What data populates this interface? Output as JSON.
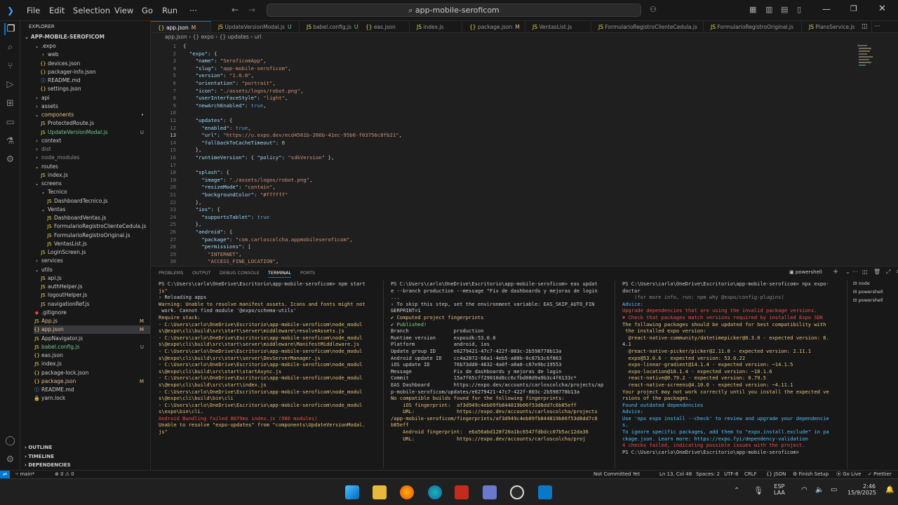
{
  "menu": [
    "File",
    "Edit",
    "Selection",
    "View",
    "Go",
    "Run"
  ],
  "menu_more": "···",
  "search": "app-mobile-seroficom",
  "explorer": {
    "title": "EXPLORER",
    "root": "APP-MOBILE-SEROFICOM",
    "items": [
      {
        "label": ".expo",
        "depth": 1,
        "kind": "folder-open",
        "c": "#ccc"
      },
      {
        "label": "web",
        "depth": 2,
        "kind": "folder",
        "c": "#ccc"
      },
      {
        "label": "devices.json",
        "depth": 2,
        "kind": "json",
        "c": "#ccc"
      },
      {
        "label": "packager-info.json",
        "depth": 2,
        "kind": "json",
        "c": "#ccc"
      },
      {
        "label": "README.md",
        "depth": 2,
        "kind": "md",
        "c": "#ccc"
      },
      {
        "label": "settings.json",
        "depth": 2,
        "kind": "json",
        "c": "#ccc"
      },
      {
        "label": "api",
        "depth": 1,
        "kind": "folder",
        "c": "#ccc"
      },
      {
        "label": "assets",
        "depth": 1,
        "kind": "folder",
        "c": "#ccc"
      },
      {
        "label": "components",
        "depth": 1,
        "kind": "folder-open",
        "c": "#e2c08d",
        "badge": "•"
      },
      {
        "label": "ProtectedRoute.js",
        "depth": 2,
        "kind": "js",
        "c": "#ccc"
      },
      {
        "label": "UpdateVersionModal.js",
        "depth": 2,
        "kind": "js",
        "c": "#73c991",
        "badge": "U"
      },
      {
        "label": "context",
        "depth": 1,
        "kind": "folder",
        "c": "#ccc"
      },
      {
        "label": "dist",
        "depth": 1,
        "kind": "folder",
        "c": "#8c8c8c"
      },
      {
        "label": "node_modules",
        "depth": 1,
        "kind": "folder",
        "c": "#8c8c8c"
      },
      {
        "label": "routes",
        "depth": 1,
        "kind": "folder-open",
        "c": "#ccc"
      },
      {
        "label": "index.js",
        "depth": 2,
        "kind": "js",
        "c": "#ccc"
      },
      {
        "label": "screens",
        "depth": 1,
        "kind": "folder-open",
        "c": "#ccc"
      },
      {
        "label": "Tecnico",
        "depth": 2,
        "kind": "folder-open",
        "c": "#ccc"
      },
      {
        "label": "DashboardTecnico.js",
        "depth": 3,
        "kind": "js",
        "c": "#ccc"
      },
      {
        "label": "Ventas",
        "depth": 2,
        "kind": "folder-open",
        "c": "#ccc"
      },
      {
        "label": "DashboardVentas.js",
        "depth": 3,
        "kind": "js",
        "c": "#ccc"
      },
      {
        "label": "FormularioRegistroClienteCedula.js",
        "depth": 3,
        "kind": "js",
        "c": "#ccc"
      },
      {
        "label": "FormularioRegistroOriginal.js",
        "depth": 3,
        "kind": "js",
        "c": "#ccc"
      },
      {
        "label": "VentasList.js",
        "depth": 3,
        "kind": "js",
        "c": "#ccc"
      },
      {
        "label": "LoginScreen.js",
        "depth": 2,
        "kind": "js",
        "c": "#ccc"
      },
      {
        "label": "services",
        "depth": 1,
        "kind": "folder",
        "c": "#ccc"
      },
      {
        "label": "utils",
        "depth": 1,
        "kind": "folder-open",
        "c": "#ccc"
      },
      {
        "label": "api.js",
        "depth": 2,
        "kind": "js",
        "c": "#ccc"
      },
      {
        "label": "authHelper.js",
        "depth": 2,
        "kind": "js",
        "c": "#ccc"
      },
      {
        "label": "logoutHelper.js",
        "depth": 2,
        "kind": "js",
        "c": "#ccc"
      },
      {
        "label": "navigationRef.js",
        "depth": 2,
        "kind": "js",
        "c": "#ccc"
      },
      {
        "label": ".gitignore",
        "depth": 1,
        "kind": "git",
        "c": "#ccc"
      },
      {
        "label": "App.js",
        "depth": 1,
        "kind": "js",
        "c": "#e2c08d",
        "badge": "M"
      },
      {
        "label": "app.json",
        "depth": 1,
        "kind": "json",
        "c": "#e2c08d",
        "badge": "M",
        "selected": true
      },
      {
        "label": "AppNavigator.js",
        "depth": 1,
        "kind": "js",
        "c": "#ccc"
      },
      {
        "label": "babel.config.js",
        "depth": 1,
        "kind": "js",
        "c": "#73c991",
        "badge": "U"
      },
      {
        "label": "eas.json",
        "depth": 1,
        "kind": "json",
        "c": "#ccc"
      },
      {
        "label": "index.js",
        "depth": 1,
        "kind": "js",
        "c": "#ccc"
      },
      {
        "label": "package-lock.json",
        "depth": 1,
        "kind": "json",
        "c": "#ccc"
      },
      {
        "label": "package.json",
        "depth": 1,
        "kind": "json",
        "c": "#e2c08d",
        "badge": "M"
      },
      {
        "label": "README.md",
        "depth": 1,
        "kind": "md",
        "c": "#ccc"
      },
      {
        "label": "yarn.lock",
        "depth": 1,
        "kind": "lock",
        "c": "#ccc"
      }
    ],
    "sections": [
      "OUTLINE",
      "TIMELINE",
      "DEPENDENCIES"
    ]
  },
  "tabs": [
    {
      "label": "app.json",
      "badge": "M",
      "active": true
    },
    {
      "label": "UpdateVersionModal.js",
      "badge": "U"
    },
    {
      "label": "babel.config.js",
      "badge": "U"
    },
    {
      "label": "eas.json"
    },
    {
      "label": "index.js"
    },
    {
      "label": "package.json",
      "badge": "M"
    },
    {
      "label": "VentasList.js"
    },
    {
      "label": "FormularioRegistroClienteCedula.js"
    },
    {
      "label": "FormularioRegistroOriginal.js"
    },
    {
      "label": "PlansService.js"
    }
  ],
  "breadcrumb": "app.json › {} expo › {} updates › url",
  "code": [
    "{",
    "  \"expo\": {",
    "    \"name\": \"SeroficomApp\",",
    "    \"slug\": \"app-mobile-seroficom\",",
    "    \"version\": \"1.0.0\",",
    "    \"orientation\": \"portrait\",",
    "    \"icon\": \"./assets/logos/robot.png\",",
    "    \"userInterfaceStyle\": \"light\",",
    "    \"newArchEnabled\": true,",
    "",
    "    \"updates\": {",
    "      \"enabled\": true,",
    "      \"url\": \"https://u.expo.dev/ecd4561b-266b-41ec-95b6-f03756c8fb21\",",
    "      \"fallbackToCacheTimeout\": 0",
    "    },",
    "    \"runtimeVersion\": { \"policy\": \"sdkVersion\" },",
    "",
    "    \"splash\": {",
    "      \"image\": \"./assets/logos/robot.png\",",
    "      \"resizeMode\": \"contain\",",
    "      \"backgroundColor\": \"#ffffff\"",
    "    },",
    "    \"ios\": {",
    "      \"supportsTablet\": true",
    "    },",
    "    \"android\": {",
    "      \"package\": \"com.carloscolcha.appmobileseroficom\",",
    "      \"permissions\": [",
    "        \"INTERNET\",",
    "        \"ACCESS_FINE_LOCATION\","
  ],
  "panel_tabs": [
    "PROBLEMS",
    "OUTPUT",
    "DEBUG CONSOLE",
    "TERMINAL",
    "PORTS"
  ],
  "terminal_shell": "powershell",
  "terminal_list": [
    "node",
    "powershell",
    "powershell"
  ],
  "term1": [
    "PS C:\\Users\\carlo\\OneDrive\\Escritorio\\app-mobile-seroficom> npm start",
    "js\"",
    "› Reloading apps",
    "Warning: Unable to resolve manifest assets. Icons and fonts might not",
    " work. Cannot find module '@expo/schema-utils'",
    "Require stack:",
    "- C:\\Users\\carlo\\OneDrive\\Escritorio\\app-mobile-seroficom\\node_modul",
    "s\\@expo\\cli\\build\\src\\start\\server\\middleware\\resolveAssets.js",
    "- C:\\Users\\carlo\\OneDrive\\Escritorio\\app-mobile-seroficom\\node_modul",
    "s\\@expo\\cli\\build\\src\\start\\server\\middleware\\ManifestMiddleware.js",
    "- C:\\Users\\carlo\\OneDrive\\Escritorio\\app-mobile-seroficom\\node_modul",
    "s\\@expo\\cli\\build\\src\\start\\server\\DevServerManager.js",
    "- C:\\Users\\carlo\\OneDrive\\Escritorio\\app-mobile-seroficom\\node_modul",
    "s\\@expo\\cli\\build\\src\\start\\startAsync.js",
    "- C:\\Users\\carlo\\OneDrive\\Escritorio\\app-mobile-seroficom\\node_modul",
    "s\\@expo\\cli\\build\\src\\start\\index.js",
    "- C:\\Users\\carlo\\OneDrive\\Escritorio\\app-mobile-seroficom\\node_modul",
    "s\\@expo\\cli\\build\\bin\\cli",
    "- C:\\Users\\carlo\\OneDrive\\Escritorio\\app-mobile-seroficom\\node_modul",
    "s\\expo\\bin\\cli.",
    "Android Bundling failed 8079ms index.js (980 modules)",
    "Unable to resolve \"expo-updates\" from \"components\\UpdateVersionModal.",
    "js\""
  ],
  "term2": [
    "PS C:\\Users\\carlo\\OneDrive\\Escritorio\\app-mobile-seroficom> eas updat",
    "e --branch production --message \"Fix de dashboards y mejoras de login",
    "",
    "...",
    "› To skip this step, set the environment variable: EAS_SKIP_AUTO_FIN",
    "GERPRINT=1",
    "✔ Computed project fingerprints",
    "✔ Published!",
    "",
    "Branch               production",
    "Runtime version      exposdk:53.0.0",
    "Platform             android, ios",
    "Update group ID      e6279421-47c7-422f-803c-2b598778b13a",
    "Android update ID    cc4a2872-66a1-4eb5-a80b-0c87b3c6f863",
    "iOS update ID        76b73dd0-4632-4a0f-a0a8-c67e9bc19553",
    "Message              Fix de dashboards y mejoras de login",
    "Commit               15a7f65cff29010d8cc6cfbd08d9a9b3c4f6133c*",
    "EAS Dashboard        https://expo.dev/accounts/carloscolcha/projects/ap",
    "p-mobile-seroficom/updates/e6279421-47c7-422f-803c-2b598778b13a",
    "",
    "No compatible builds found for the following fingerprints:",
    "    iOS fingerprint:  af3d949c4eb09fb844819b06f53d8dd7c6b85eff",
    "    URL:              https://expo.dev/accounts/carloscolcha/projects",
    "/app-mobile-seroficom/fingerprints/af3d949c4eb09fb844819b06f53d8dd7c6",
    "b85eff",
    "",
    "    Android fingerprint:  e6a56abd128f20a1bc6547fdbdcc07b5ac12da36",
    "    URL:              https://expo.dev/accounts/carloscolcha/proj"
  ],
  "term3": [
    "PS C:\\Users\\carlo\\OneDrive\\Escritorio\\app-mobile-seroficom> npx expo-",
    "doctor",
    "    (for more info, run: npm why @expo/config-plugins)",
    "Advice:",
    "Upgrade dependencies that are using the invalid package versions.",
    "",
    "✖ Check that packages match versions required by installed Expo SDK",
    "The following packages should be updated for best compatibility with",
    " the installed expo version:",
    "  @react-native-community/datetimepicker@8.3.0 - expected version: 8.",
    "4.1",
    "  @react-native-picker/picker@2.11.0 - expected version: 2.11.1",
    "  expo@53.0.6 - expected version: 53.0.22",
    "  expo-linear-gradient@14.1.4 - expected version: ~14.1.5",
    "  expo-location@18.1.4 - expected version: ~18.1.6",
    "  react-native@0.79.2 - expected version: 0.79.5",
    "  react-native-screens@4.10.0 - expected version: ~4.11.1",
    "Your project may not work correctly until you install the expected ve",
    "rsions of the packages.",
    "Found outdated dependencies",
    "Advice:",
    "Use 'npx expo install --check' to review and upgrade your dependencie",
    "s.",
    "To ignore specific packages, add them to \"expo.install.exclude\" in pa",
    "ckage.json. Learn more: https://expo.fyi/dependency-validation",
    "",
    "4 checks failed, indicating possible issues with the project.",
    "PS C:\\Users\\carlo\\OneDrive\\Escritorio\\app-mobile-seroficom> "
  ],
  "status": {
    "branch": "main*",
    "problems": "⊗ 0 ⚠ 0",
    "not_committed": "Not Committed Yet",
    "position": "Ln 13, Col 48",
    "spaces": "Spaces: 2",
    "encoding": "UTF-8",
    "eol": "CRLF",
    "lang": "{} JSON",
    "finish": "Finish Setup",
    "golive": "Go Live",
    "prettier": "Prettier"
  },
  "taskbar": {
    "lang1": "ESP",
    "lang2": "LAA",
    "time": "2:46",
    "date": "15/9/2025"
  }
}
